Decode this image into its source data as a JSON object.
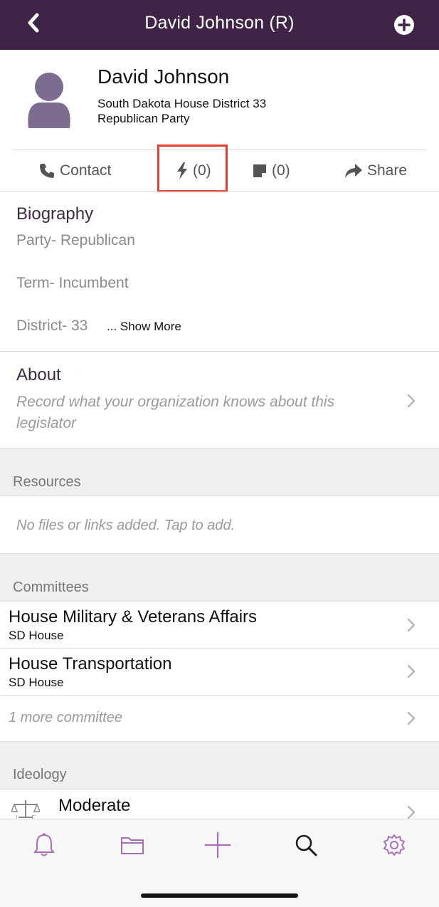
{
  "header": {
    "title": "David Johnson (R)",
    "back_icon": "chevron-left-icon",
    "add_icon": "plus-circle-icon"
  },
  "profile": {
    "name": "David Johnson",
    "district": "South Dakota House District 33",
    "party": "Republican Party",
    "avatar_icon": "person-icon"
  },
  "actions": {
    "contact_label": "Contact",
    "activity_count": "(0)",
    "notes_count": "(0)",
    "share_label": "Share"
  },
  "biography": {
    "title": "Biography",
    "party": "Party- Republican",
    "term": "Term- Incumbent",
    "district": "District- 33",
    "show_more": "... Show More"
  },
  "about": {
    "title": "About",
    "description": "Record what your organization knows about this legislator"
  },
  "resources": {
    "header": "Resources",
    "empty": "No files or links added. Tap to add."
  },
  "committees": {
    "header": "Committees",
    "items": [
      {
        "name": "House Military & Veterans Affairs",
        "chamber": "SD House"
      },
      {
        "name": "House Transportation",
        "chamber": "SD House"
      }
    ],
    "more": "1 more committee"
  },
  "ideology": {
    "header": "Ideology",
    "value": "Moderate"
  },
  "tabbar": {
    "icons": [
      "bell-icon",
      "folder-icon",
      "plus-icon",
      "search-icon",
      "gear-icon"
    ]
  },
  "colors": {
    "navbar": "#3f2447",
    "accent": "#a86fb8",
    "highlight": "#e0412f"
  }
}
